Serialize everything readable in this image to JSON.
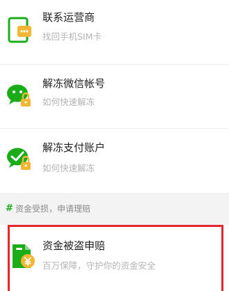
{
  "items": [
    {
      "title": "联系运营商",
      "subtitle": "找回手机SIM卡",
      "icon": "carrier-card-icon"
    },
    {
      "title": "解冻微信帐号",
      "subtitle": "如何快速解冻",
      "icon": "wechat-lock-icon"
    },
    {
      "title": "解冻支付账户",
      "subtitle": "如何快速解冻",
      "icon": "pay-lock-icon"
    }
  ],
  "section": {
    "hash": "#",
    "title": "资金受损，申请理赔"
  },
  "claim": {
    "title": "资金被盗申赔",
    "subtitle": "百万保障，守护你的资金安全",
    "icon": "fund-claim-icon"
  },
  "colors": {
    "wechat_green": "#1aad19",
    "lock_yellow": "#f2b632",
    "highlight_red": "#e5262d"
  }
}
